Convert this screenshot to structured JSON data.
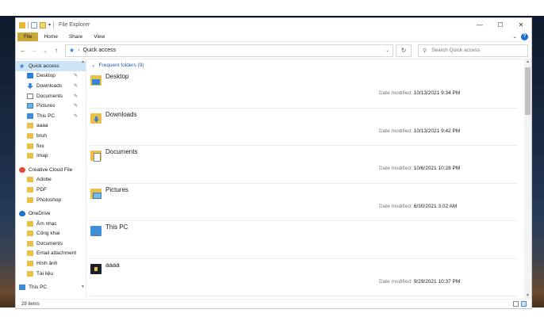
{
  "window": {
    "title": "File Explorer",
    "controls": {
      "minimize": "—",
      "maximize": "☐",
      "close": "✕"
    }
  },
  "ribbon": {
    "tabs": [
      "File",
      "Home",
      "Share",
      "View"
    ],
    "expand": "⌄",
    "help": "?"
  },
  "addressbar": {
    "back": "←",
    "forward": "→",
    "recent": "⌄",
    "up": "↑",
    "breadcrumb": "Quick access",
    "dropdown": "⌄",
    "refresh": "↻",
    "search_placeholder": "Search Quick access"
  },
  "sidebar": {
    "quick_access": "Quick access",
    "items": [
      {
        "label": "Desktop",
        "icon": "desktop-icon",
        "pinned": true
      },
      {
        "label": "Downloads",
        "icon": "downloads-icon",
        "pinned": true
      },
      {
        "label": "Documents",
        "icon": "documents-icon",
        "pinned": true
      },
      {
        "label": "Pictures",
        "icon": "pictures-icon",
        "pinned": true
      },
      {
        "label": "This PC",
        "icon": "this-pc-icon",
        "pinned": true
      },
      {
        "label": "aaaa",
        "icon": "folder-icon",
        "pinned": false
      },
      {
        "label": "bruh",
        "icon": "folder-icon",
        "pinned": false
      },
      {
        "label": "fixx",
        "icon": "folder-icon",
        "pinned": false
      },
      {
        "label": "Imap",
        "icon": "folder-icon",
        "pinned": false
      }
    ],
    "creative_cloud": "Creative Cloud File",
    "cc_items": [
      "Adobe",
      "PDF",
      "Photoshop"
    ],
    "onedrive": "OneDrive",
    "onedrive_items": [
      "Âm nhạc",
      "Công khai",
      "Documents",
      "Email attachment",
      "Hình ảnh",
      "Tài liệu"
    ],
    "this_pc": "This PC"
  },
  "main": {
    "group_header": "Frequent folders (9)",
    "date_label": "Date modified:",
    "tiles": [
      {
        "name": "Desktop",
        "icon": "desktop-folder-icon",
        "date": "10/13/2021 9:34 PM"
      },
      {
        "name": "Downloads",
        "icon": "downloads-folder-icon",
        "date": "10/13/2021 9:42 PM"
      },
      {
        "name": "Documents",
        "icon": "documents-folder-icon",
        "date": "10/6/2021 10:28 PM"
      },
      {
        "name": "Pictures",
        "icon": "pictures-folder-icon",
        "date": "6/30/2021 3:02 AM"
      },
      {
        "name": "This PC",
        "icon": "this-pc-icon",
        "date": ""
      },
      {
        "name": "aaaa",
        "icon": "dark-folder-icon",
        "date": "9/29/2021 10:37 PM"
      }
    ]
  },
  "statusbar": {
    "items_count": "29 items"
  },
  "colors": {
    "accent": "#2f7bd6",
    "selection": "#cce4f7",
    "file_tab": "#c8a93a"
  }
}
